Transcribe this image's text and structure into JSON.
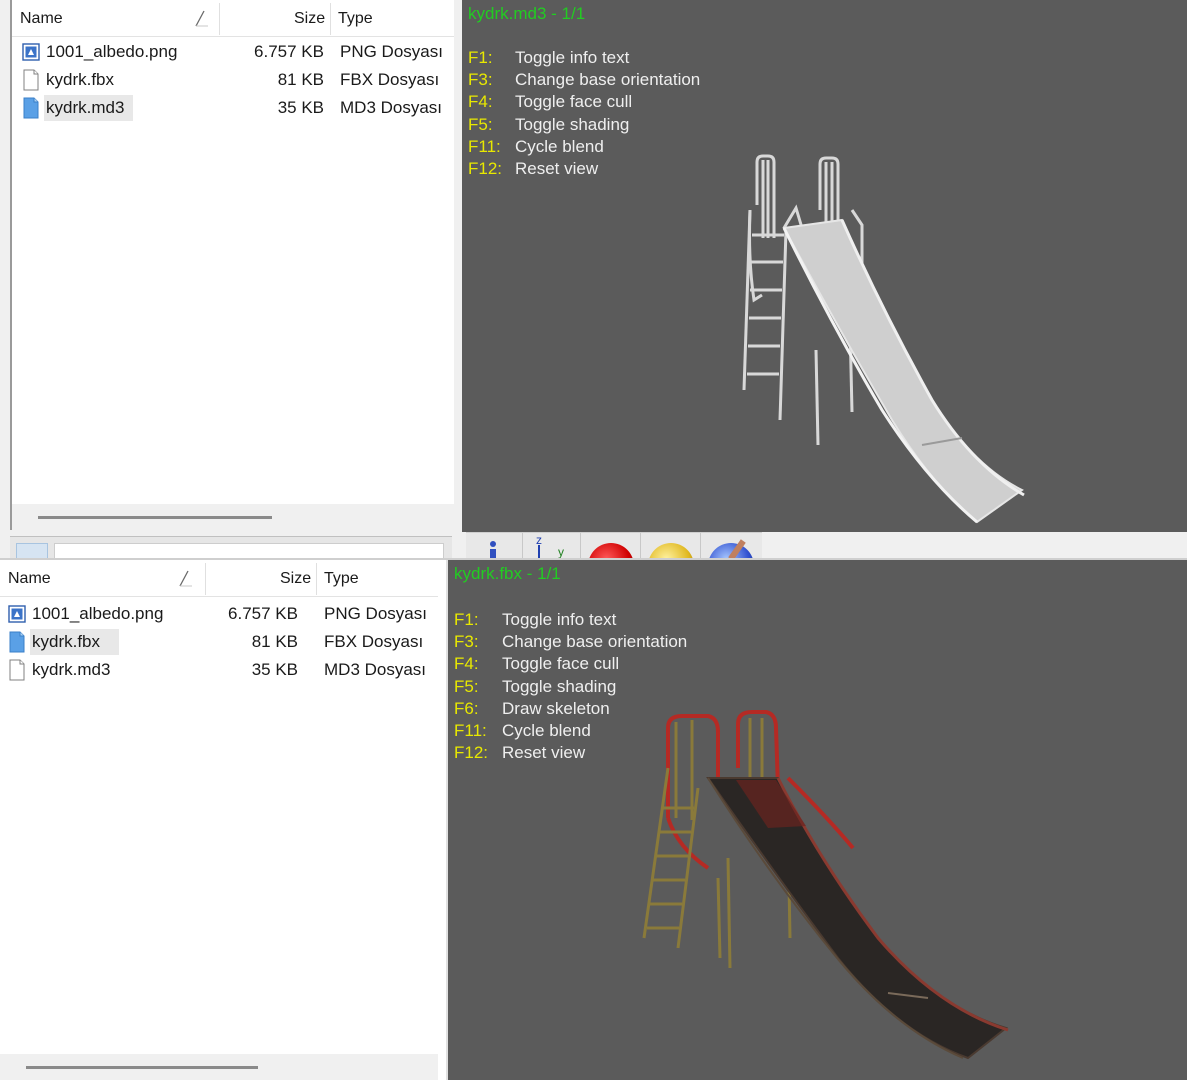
{
  "columns": {
    "name": "Name",
    "size": "Size",
    "type": "Type"
  },
  "top": {
    "files": [
      {
        "name": "1001_albedo.png",
        "size": "6.757 KB",
        "type": "PNG Dosyası",
        "icon": "image-file-icon"
      },
      {
        "name": "kydrk.fbx",
        "size": "81 KB",
        "type": "FBX Dosyası",
        "icon": "blank-file-icon"
      },
      {
        "name": "kydrk.md3",
        "size": "35 KB",
        "type": "MD3 Dosyası",
        "icon": "blue-file-icon"
      }
    ],
    "selected_index": 2,
    "viewer": {
      "title": "kydrk.md3 - 1/1",
      "keys": [
        {
          "key": "F1:",
          "desc": "Toggle info text"
        },
        {
          "key": "F3:",
          "desc": "Change base orientation"
        },
        {
          "key": "F4:",
          "desc": "Toggle face cull"
        },
        {
          "key": "F5:",
          "desc": "Toggle shading"
        },
        {
          "key": "F11:",
          "desc": "Cycle blend"
        },
        {
          "key": "F12:",
          "desc": "Reset view"
        }
      ]
    },
    "toolbar_axis_labels": {
      "z": "z",
      "y": "y"
    }
  },
  "bottom": {
    "files": [
      {
        "name": "1001_albedo.png",
        "size": "6.757 KB",
        "type": "PNG Dosyası",
        "icon": "image-file-icon"
      },
      {
        "name": "kydrk.fbx",
        "size": "81 KB",
        "type": "FBX Dosyası",
        "icon": "blue-file-icon"
      },
      {
        "name": "kydrk.md3",
        "size": "35 KB",
        "type": "MD3 Dosyası",
        "icon": "blank-file-icon"
      }
    ],
    "selected_index": 1,
    "viewer": {
      "title": "kydrk.fbx - 1/1",
      "keys": [
        {
          "key": "F1:",
          "desc": "Toggle info text"
        },
        {
          "key": "F3:",
          "desc": "Change base orientation"
        },
        {
          "key": "F4:",
          "desc": "Toggle face cull"
        },
        {
          "key": "F5:",
          "desc": "Toggle shading"
        },
        {
          "key": "F6:",
          "desc": "Draw skeleton"
        },
        {
          "key": "F11:",
          "desc": "Cycle blend"
        },
        {
          "key": "F12:",
          "desc": "Reset view"
        }
      ]
    }
  },
  "colors": {
    "viewer_bg": "#5b5b5b",
    "title_green": "#22cc22",
    "key_yellow": "#e8e800",
    "selection_gray": "#e8e8e8",
    "untextured_model": "#d8d8d8",
    "rust_red": "#b52a24",
    "slide_dark": "#2a2624"
  }
}
